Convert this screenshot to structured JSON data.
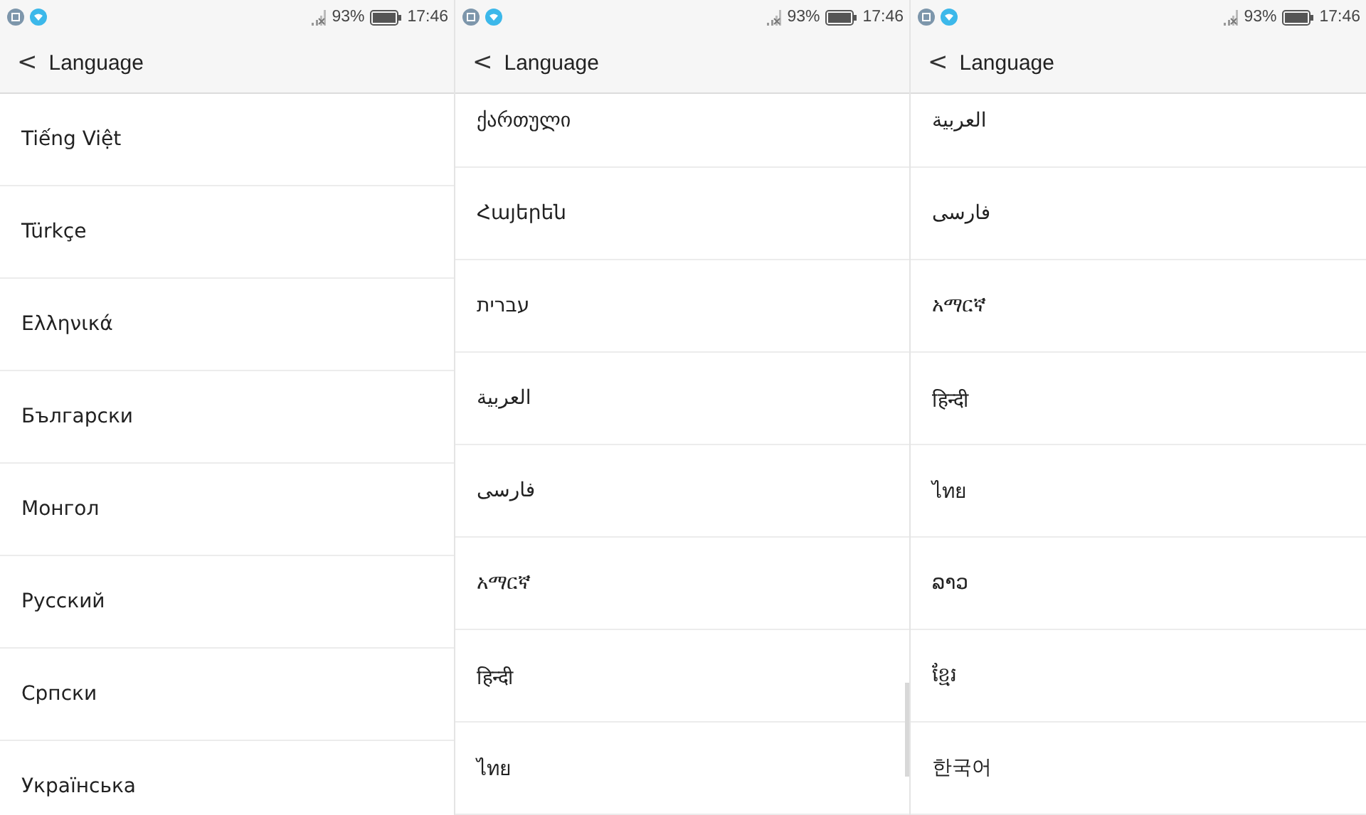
{
  "left_screen": {
    "status_bar": {
      "battery": "93%",
      "time": "17:46"
    },
    "header": {
      "back": "<",
      "title": "Language"
    },
    "languages": [
      "Tiếng Việt",
      "Türkçe",
      "Ελληνικά",
      "Български",
      "Монгол",
      "Русский",
      "Српски",
      "Українська"
    ]
  },
  "middle_screen": {
    "status_bar": {
      "battery": "93%",
      "time": "17:46"
    },
    "header": {
      "back": "<",
      "title": "Language"
    },
    "languages": [
      "ქართული",
      "Հայերեն",
      "עברית",
      "العربية",
      "فارسی",
      "አማርኛ",
      "हिन्दी",
      "ไทย"
    ]
  },
  "right_screen": {
    "status_bar": {
      "battery": "93%",
      "time": "17:46"
    },
    "header": {
      "back": "<",
      "title": "Language"
    },
    "languages": [
      "العربية",
      "فارسی",
      "አማርኛ",
      "हिन्दी",
      "ไทย",
      "ລາວ",
      "ខ្មែរ",
      "한국어"
    ]
  }
}
